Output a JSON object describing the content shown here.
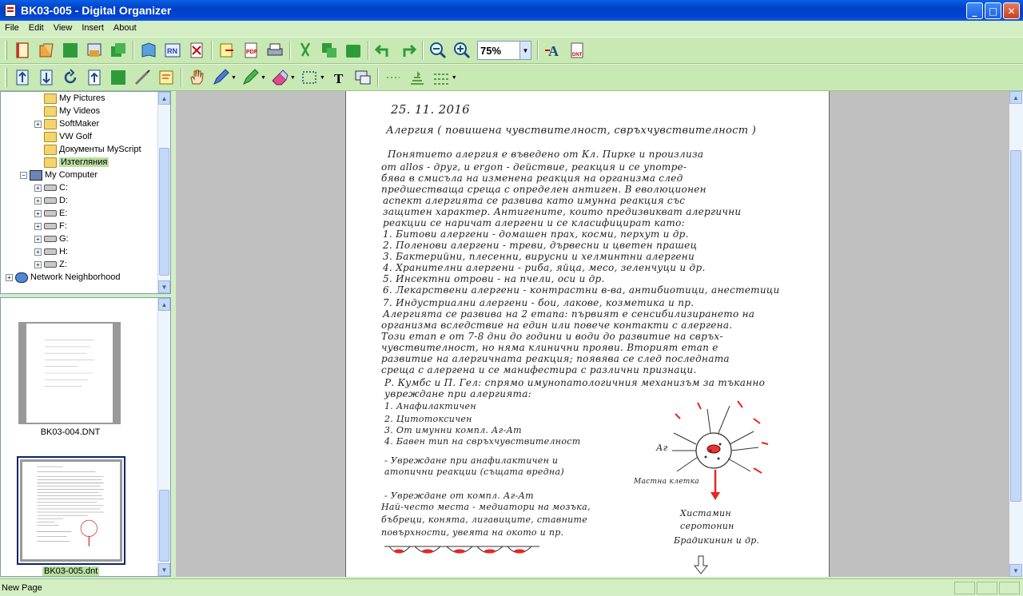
{
  "window": {
    "title": "BK03-005 - Digital Organizer"
  },
  "menu": [
    "File",
    "Edit",
    "View",
    "Insert",
    "About"
  ],
  "toolbar": {
    "zoom_value": "75%"
  },
  "tree": [
    {
      "label": "My Pictures",
      "icon": "folder-icon",
      "indent": 2,
      "expander": false
    },
    {
      "label": "My Videos",
      "icon": "folder-icon",
      "indent": 2,
      "expander": false
    },
    {
      "label": "SoftMaker",
      "icon": "folder-icon",
      "indent": 2,
      "expander": true
    },
    {
      "label": "VW Golf",
      "icon": "folder-icon",
      "indent": 2,
      "expander": false
    },
    {
      "label": "Документы MyScript",
      "icon": "folder-icon",
      "indent": 2,
      "expander": false
    },
    {
      "label": "Изтегляния",
      "icon": "folder-open-icon",
      "indent": 2,
      "expander": false,
      "selected": true
    },
    {
      "label": "My Computer",
      "icon": "computer-icon",
      "indent": 1,
      "expander": true,
      "expanded": true
    },
    {
      "label": "C:",
      "icon": "drive-icon",
      "indent": 2,
      "expander": true
    },
    {
      "label": "D:",
      "icon": "drive-icon",
      "indent": 2,
      "expander": true
    },
    {
      "label": "E:",
      "icon": "drive-icon",
      "indent": 2,
      "expander": true
    },
    {
      "label": "F:",
      "icon": "network-drive-icon",
      "indent": 2,
      "expander": true
    },
    {
      "label": "G:",
      "icon": "drive-icon",
      "indent": 2,
      "expander": true
    },
    {
      "label": "H:",
      "icon": "network-drive-icon",
      "indent": 2,
      "expander": true
    },
    {
      "label": "Z:",
      "icon": "drive-icon",
      "indent": 2,
      "expander": true
    },
    {
      "label": "Network Neighborhood",
      "icon": "network-icon",
      "indent": 0,
      "expander": true
    }
  ],
  "thumbnails": [
    {
      "caption": "BK03-004.DNT",
      "selected": false
    },
    {
      "caption": "BK03-005.dnt",
      "selected": true
    }
  ],
  "page": {
    "lines": [
      "25. 11. 2016",
      "Алергия ( повишена чувствителност, свръхчувствителност )",
      "Понятието алергия е въведено от Кл. Пирке и произлиза",
      "от allos - друг, и ergon - действие, реакция и се употре-",
      "бява в смисъла на изменена реакция на организма след",
      "предшестваща среща с определен антиген. В еволюционен",
      "аспект алергията се развива като имунна реакция със",
      "защитен характер. Антигените, които предизвикват алергични",
      "реакции се наричат алергени и се класифицират като:",
      "1. Битови алергени - домашен прах, косми, перхут и др.",
      "2. Поленови алергени - треви, дървесни и цветен прашец",
      "3. Бактерийни, плесенни, вирусни и хелминтни алергени",
      "4. Хранителни алергени - риба, яйца, месо, зеленчуци и др.",
      "5. Инсектни отрови - на пчели, оси и др.",
      "6. Лекарствени алергени - контрастни в-ва, антибиотици, анестетици",
      "7. Индустриални алергени - бои, лакове, козметика и пр.",
      "Алергията се развива на 2 етапа: първият е сенсибилизирането на",
      "организма вследствие на един или повече контакти с алергена.",
      "Този етап е от 7-8 дни до години и води до развитие на свръх-",
      "чувствителност, но няма клинични прояви. Вторият етап е",
      "развитие на алергичната реакция; появява се след последната",
      "среща с алергена и се манифестира с различни признаци.",
      "Р. Кумбс и П. Гел: спрямо имунопатологичния механизъм за тъканно",
      "увреждане при алергията:",
      "1. Анафилактичен",
      "2. Цитотоксичен",
      "3. От имунни компл. Аг-Ат",
      "4. Бавен тип на свръхчувствителност",
      "- Увреждане при анафилактичен и",
      "атопични реакции (същата вредна)",
      "- Увреждане от компл. Аг-Ат",
      "Най-често места - медиатори на мозъка,",
      "бъбреци, конята, лигавиците, ставните",
      "повърхности, увеята на окото и пр."
    ],
    "diagram_labels": [
      "Мастна клетка",
      "Хистамин",
      "серотонин",
      "Брадикинин и др.",
      "Аг"
    ]
  },
  "status": {
    "text": "New Page"
  },
  "colors": {
    "chrome": "#d4eec4",
    "titlebar": "#0044d0",
    "workspace": "#c0c0c0"
  }
}
